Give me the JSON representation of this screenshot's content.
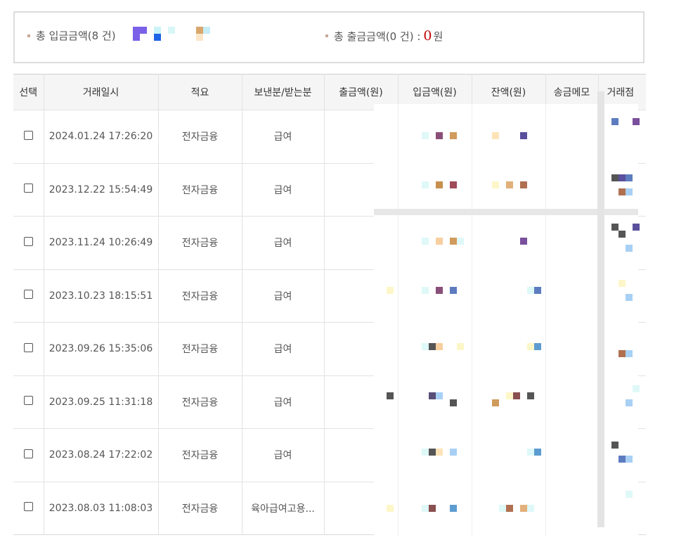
{
  "summary": {
    "deposit_label": "총 입금금액(8 건)",
    "withdraw_label": "총 출금금액(0 건) :",
    "withdraw_amount": "0",
    "withdraw_unit": "원"
  },
  "table": {
    "headers": [
      "선택",
      "거래일시",
      "적요",
      "보낸분/받는분",
      "출금액(원)",
      "입금액(원)",
      "잔액(원)",
      "송금메모",
      "거래점"
    ],
    "rows": [
      {
        "datetime": "2024.01.24 17:26:20",
        "summary": "전자금융",
        "counterparty": "급여"
      },
      {
        "datetime": "2023.12.22 15:54:49",
        "summary": "전자금융",
        "counterparty": "급여"
      },
      {
        "datetime": "2023.11.24 10:26:49",
        "summary": "전자금융",
        "counterparty": "급여"
      },
      {
        "datetime": "2023.10.23 18:15:51",
        "summary": "전자금융",
        "counterparty": "급여"
      },
      {
        "datetime": "2023.09.26 15:35:06",
        "summary": "전자금융",
        "counterparty": "급여"
      },
      {
        "datetime": "2023.09.25 11:31:18",
        "summary": "전자금융",
        "counterparty": "급여"
      },
      {
        "datetime": "2023.08.24 17:22:02",
        "summary": "전자금융",
        "counterparty": "급여"
      },
      {
        "datetime": "2023.08.03 11:08:03",
        "summary": "전자금융",
        "counterparty": "육아급여고용..."
      }
    ]
  },
  "colors": {
    "accent_red": "#c00000",
    "header_bg": "#f5f5f5",
    "border": "#e2e2e2"
  }
}
